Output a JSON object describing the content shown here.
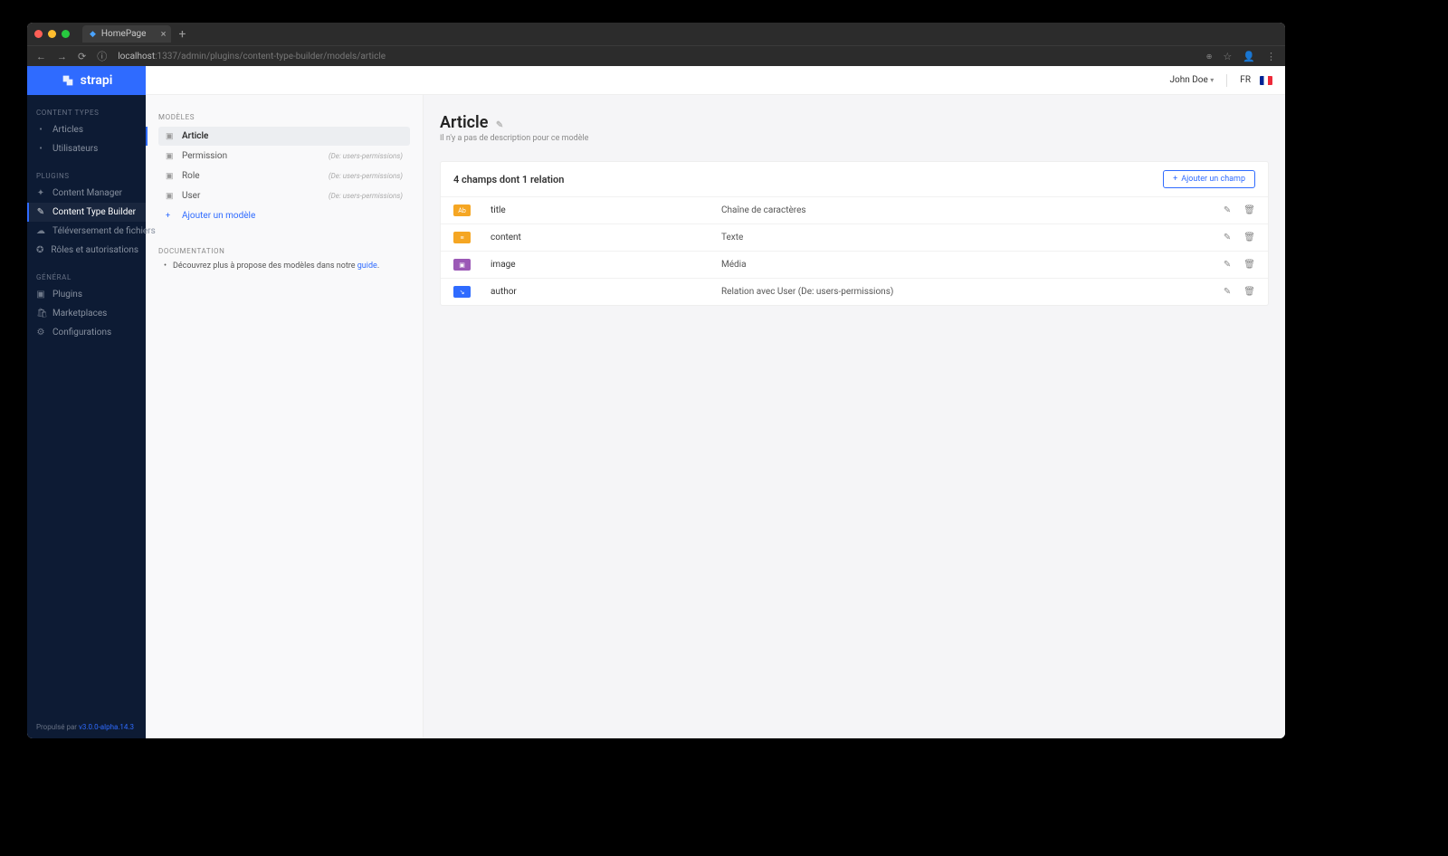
{
  "browser": {
    "tab_title": "HomePage",
    "url_host": "localhost",
    "url_path": ":1337/admin/plugins/content-type-builder/models/article"
  },
  "brand": "strapi",
  "topbar": {
    "user": "John Doe",
    "lang": "FR"
  },
  "sidebar": {
    "sections": [
      {
        "title": "CONTENT TYPES",
        "items": [
          {
            "icon": "•",
            "label": "Articles"
          },
          {
            "icon": "•",
            "label": "Utilisateurs"
          }
        ]
      },
      {
        "title": "PLUGINS",
        "items": [
          {
            "icon": "✦",
            "label": "Content Manager"
          },
          {
            "icon": "✎",
            "label": "Content Type Builder",
            "active": true
          },
          {
            "icon": "☁",
            "label": "Téléversement de fichiers"
          },
          {
            "icon": "✪",
            "label": "Rôles et autorisations"
          }
        ]
      },
      {
        "title": "GÉNÉRAL",
        "items": [
          {
            "icon": "▣",
            "label": "Plugins"
          },
          {
            "icon": "🛍",
            "label": "Marketplaces"
          },
          {
            "icon": "⚙",
            "label": "Configurations"
          }
        ]
      }
    ],
    "footer_prefix": "Propulsé par ",
    "footer_version": "v3.0.0-alpha.14.3"
  },
  "models_col": {
    "title": "MODÈLES",
    "items": [
      {
        "label": "Article",
        "active": true
      },
      {
        "label": "Permission",
        "source": "(De: users-permissions)"
      },
      {
        "label": "Role",
        "source": "(De: users-permissions)"
      },
      {
        "label": "User",
        "source": "(De: users-permissions)"
      }
    ],
    "add_label": "Ajouter un modèle",
    "doc_title": "DOCUMENTATION",
    "doc_text_prefix": "Découvrez plus à propose des modèles dans notre ",
    "doc_link": "guide",
    "doc_suffix": "."
  },
  "main": {
    "title": "Article",
    "desc": "Il n'y a pas de description pour ce modèle",
    "count_label": "4 champs dont 1 relation",
    "add_field_label": "Ajouter un champ",
    "rows": [
      {
        "badge_color": "#f5a623",
        "badge_glyph": "Ab",
        "name": "title",
        "type": "Chaîne de caractères"
      },
      {
        "badge_color": "#f5a623",
        "badge_glyph": "≡",
        "name": "content",
        "type": "Texte"
      },
      {
        "badge_color": "#9b59b6",
        "badge_glyph": "▣",
        "name": "image",
        "type": "Média"
      },
      {
        "badge_color": "#2f6bff",
        "badge_glyph": "↘",
        "name": "author",
        "type": "Relation avec User (De: users-permissions)"
      }
    ]
  }
}
